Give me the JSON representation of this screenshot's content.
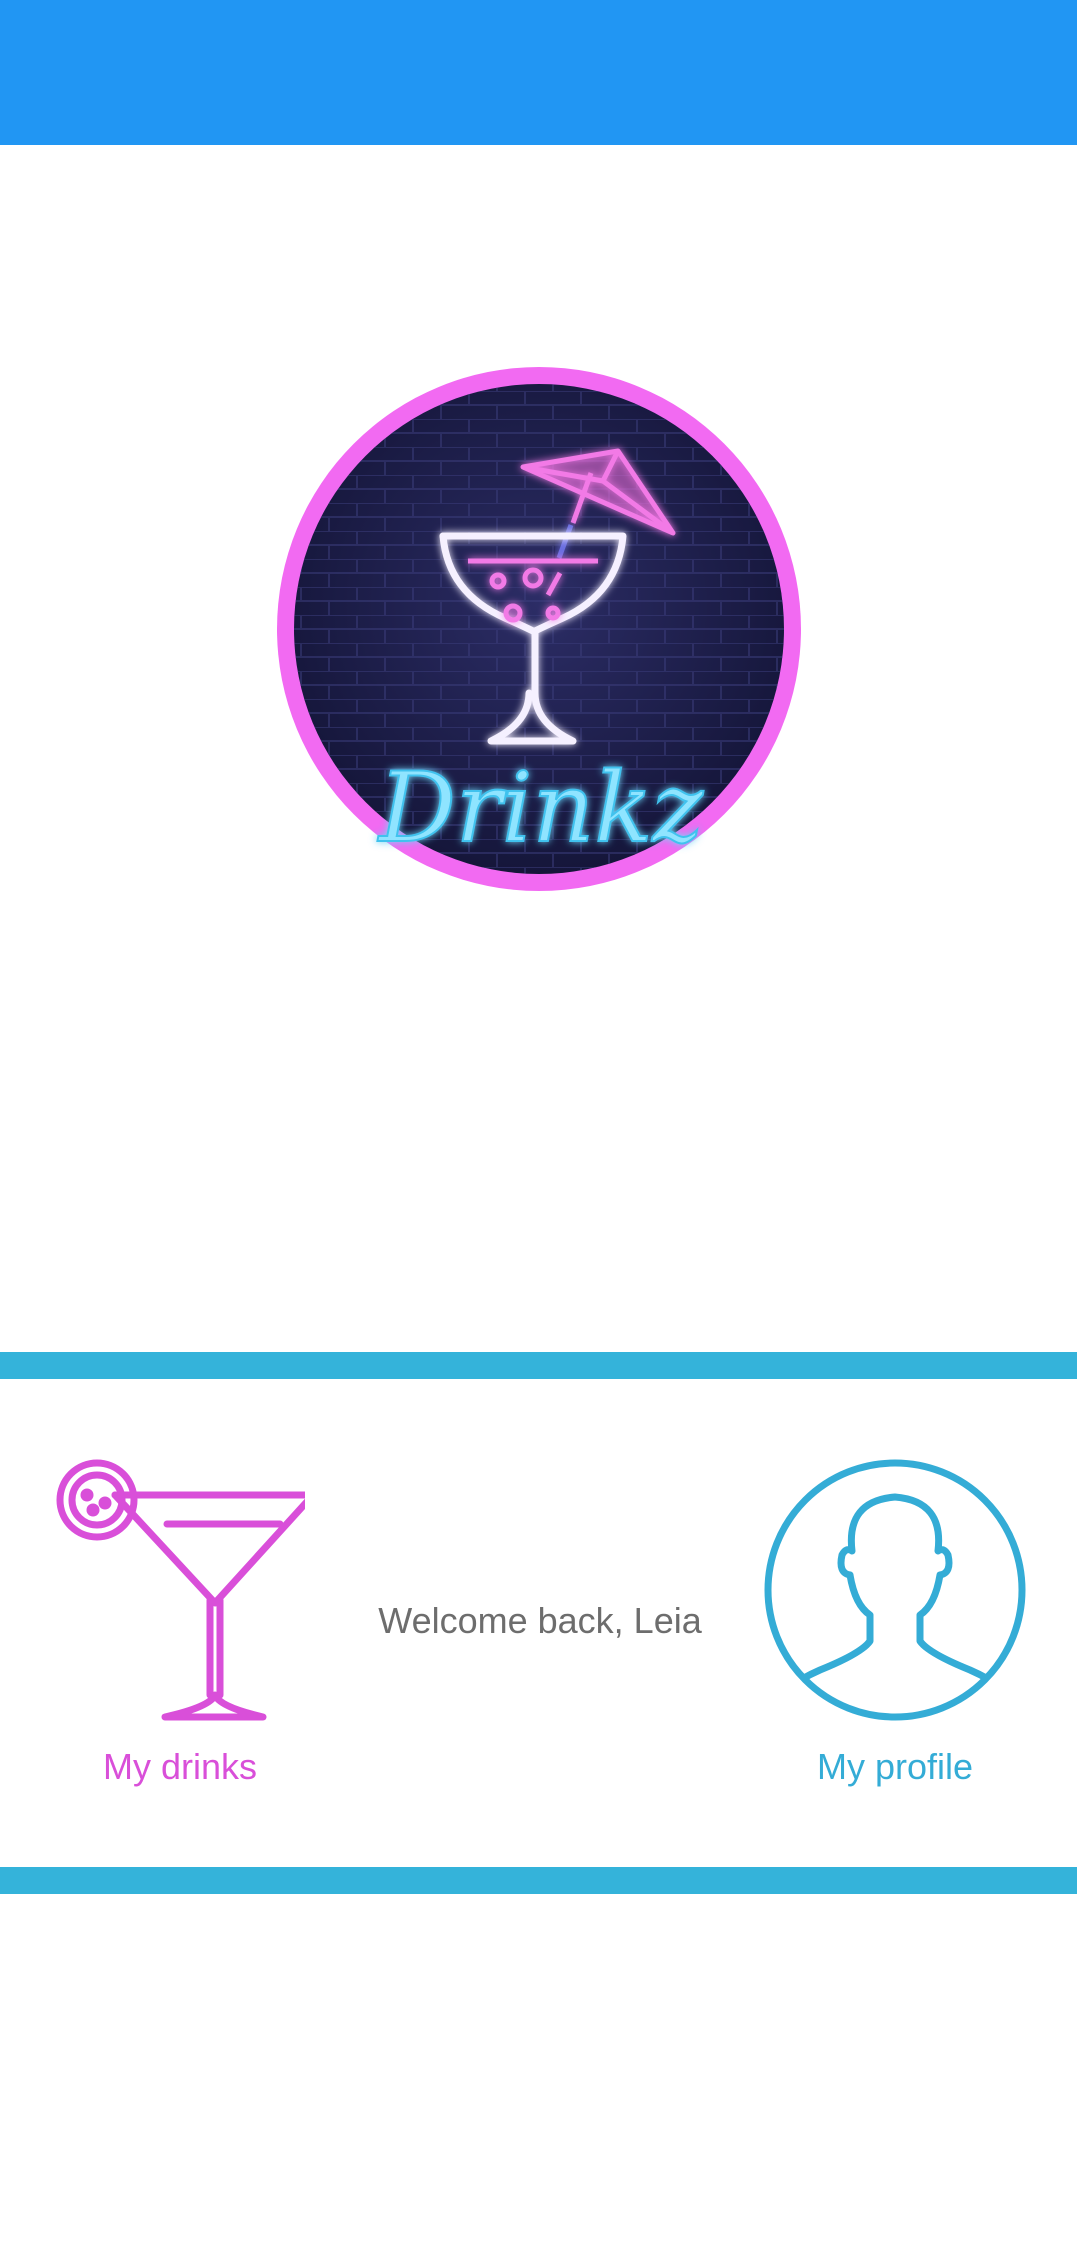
{
  "app": {
    "logo_text": "Drinkz"
  },
  "nav": {
    "drinks": {
      "label": "My drinks",
      "icon": "cocktail-glass-icon"
    },
    "profile": {
      "label": "My profile",
      "icon": "user-avatar-icon"
    }
  },
  "welcome": {
    "text": "Welcome back, Leia"
  },
  "colors": {
    "app_bar": "#2196F3",
    "divider": "#34B3DA",
    "drinks_accent": "#D94FD9",
    "profile_accent": "#34ACD6",
    "logo_ring": "#F26AF2",
    "logo_background": "#1E1F4A"
  }
}
